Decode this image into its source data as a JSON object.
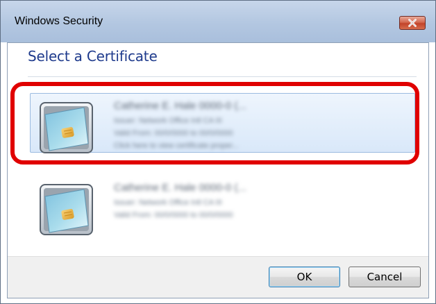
{
  "window": {
    "title": "Windows Security",
    "close_icon": "close-x-icon"
  },
  "dialog": {
    "heading": "Select a Certificate"
  },
  "certificates": [
    {
      "selected": true,
      "icon": "smart-card-certificate-icon",
      "name": "Catherine E. Hale 0000-0 (...",
      "issuer": "Issuer: Network Office Intl CA III",
      "valid": "Valid From: 00/0/0000 to 00/0/0000",
      "extra": "Click here to view certificate proper..."
    },
    {
      "selected": false,
      "icon": "smart-card-certificate-icon",
      "name": "Catherine E. Hale 0000-0 (...",
      "issuer": "Issuer: Network Office Intl CA III",
      "valid": "Valid From: 00/0/0000 to 00/0/0000"
    }
  ],
  "buttons": {
    "ok": "OK",
    "cancel": "Cancel"
  },
  "colors": {
    "heading": "#1e3a8c",
    "highlight_ring": "#e00000",
    "selection_fill": "#d9e8f9",
    "close_button": "#c2442a"
  }
}
